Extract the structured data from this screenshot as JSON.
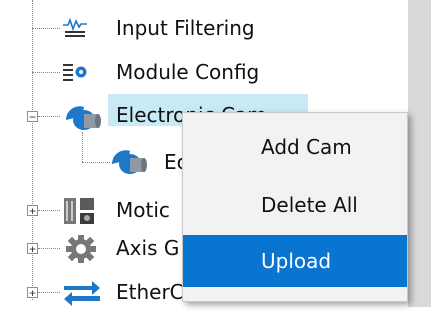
{
  "tree": {
    "items": [
      {
        "label": "Input Filtering",
        "icon": "waveform-filter-icon"
      },
      {
        "label": "Module Config",
        "icon": "module-config-icon"
      },
      {
        "label": "Electronic Cam",
        "icon": "electronic-cam-icon",
        "expander": "⊟"
      },
      {
        "label": "Ec",
        "icon": "cam-child-icon"
      },
      {
        "label": "Motic",
        "icon": "motion-device-icon",
        "expander": "⊞"
      },
      {
        "label": "Axis G",
        "icon": "axis-gear-icon",
        "expander": "⊞"
      },
      {
        "label": "EtherCAT",
        "icon": "ethercat-arrows-icon",
        "expander": "⊞"
      }
    ]
  },
  "context_menu": {
    "items": [
      {
        "label": "Add Cam"
      },
      {
        "label": "Delete All"
      },
      {
        "label": "Upload",
        "highlighted": true
      }
    ]
  },
  "colors": {
    "selection": "#c8eaf7",
    "menu_highlight": "#0a74d1",
    "icon_blue": "#1e78c8"
  }
}
